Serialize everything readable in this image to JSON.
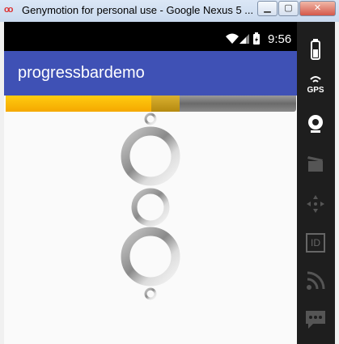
{
  "window": {
    "title": "Genymotion for personal use - Google Nexus 5 ...",
    "app_icon": "oo"
  },
  "status_bar": {
    "time": "9:56",
    "icons": [
      "wifi-icon",
      "signal-icon",
      "battery-icon"
    ]
  },
  "app_bar": {
    "title": "progressbardemo",
    "color": "#3f51b5"
  },
  "horizontal_progress": {
    "progress": 0.5,
    "secondary_progress": 0.6,
    "primary_color": "#ffc107",
    "secondary_color": "#c99a20"
  },
  "spinners": [
    {
      "name": "spinner-tiny-top",
      "size": "small"
    },
    {
      "name": "spinner-large",
      "size": "large"
    },
    {
      "name": "spinner-medium",
      "size": "normal"
    },
    {
      "name": "spinner-large-bottom",
      "size": "large"
    },
    {
      "name": "spinner-tiny-bottom",
      "size": "small"
    }
  ],
  "sidebar": {
    "items": [
      {
        "icon": "battery-icon"
      },
      {
        "icon": "gps-icon",
        "label": "GPS"
      },
      {
        "icon": "webcam-icon"
      },
      {
        "icon": "clapperboard-icon"
      },
      {
        "icon": "dpad-icon"
      },
      {
        "icon": "id-icon",
        "label": "ID"
      },
      {
        "icon": "rss-icon"
      },
      {
        "icon": "sms-icon"
      }
    ]
  }
}
